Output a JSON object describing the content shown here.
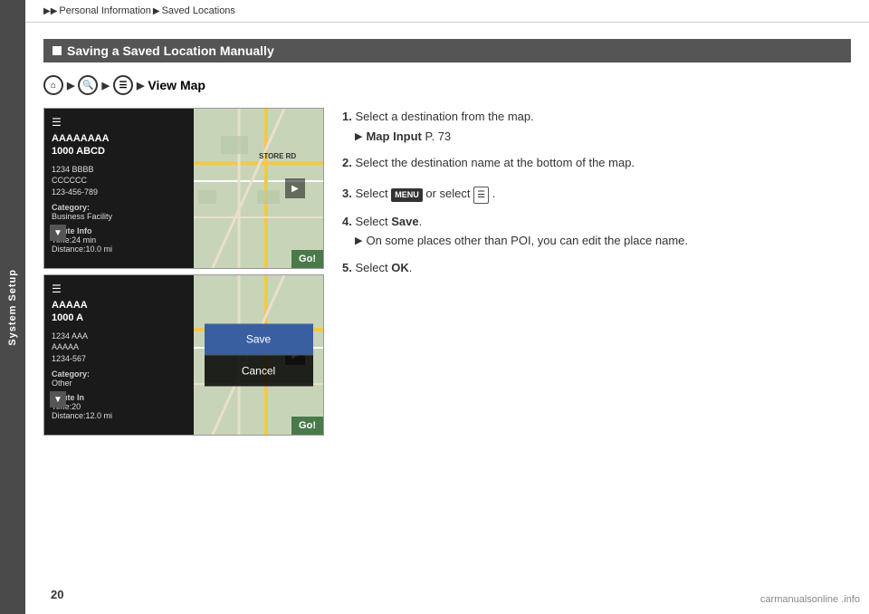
{
  "sidebar": {
    "label": "System Setup"
  },
  "breadcrumb": {
    "items": [
      "Personal Information",
      "Saved Locations"
    ]
  },
  "section": {
    "title": "Saving a Saved Location Manually"
  },
  "nav": {
    "icons": [
      "home",
      "search",
      "arrow",
      "menu"
    ],
    "label": "View Map"
  },
  "screenshot1": {
    "location_name": "AAAAAAAA\n1000 ABCD",
    "address_line1": "1234 BBBB",
    "address_line2": "CCCCCC",
    "address_line3": "123-456-789",
    "category_label": "Category:",
    "category_value": "Business Facility",
    "route_label": "Route Info",
    "route_time": "Time:24 min",
    "route_dist": "Distance:10.0 mi",
    "go_button": "Go!"
  },
  "screenshot2": {
    "location_name": "AAAAA\n1000 A",
    "address_line1": "1234 AAA",
    "address_line2": "AAAAA",
    "address_line3": "1234-567",
    "category_label": "Category:",
    "category_value": "Other",
    "route_label": "Route In",
    "route_time": "Time:20",
    "route_dist": "Distance:12.0 mi",
    "go_button": "Go!",
    "dialog": {
      "save_label": "Save",
      "cancel_label": "Cancel"
    }
  },
  "instructions": [
    {
      "num": "1.",
      "text": "Select a destination from the map.",
      "sub": {
        "icon": "arrow",
        "text": "Map Input",
        "suffix": " P. 73"
      }
    },
    {
      "num": "2.",
      "text": "Select the destination name at the bottom of the map."
    },
    {
      "num": "3.",
      "text_prefix": "Select ",
      "menu_btn": "MENU",
      "text_mid": " or select ",
      "list_btn": "≡",
      "text_suffix": "."
    },
    {
      "num": "4.",
      "text_prefix": "Select ",
      "bold": "Save",
      "text_suffix": ".",
      "sub": {
        "icon": "arrow",
        "text": "On some places other than POI, you can edit the place name."
      }
    },
    {
      "num": "5.",
      "text_prefix": "Select ",
      "bold": "OK",
      "text_suffix": "."
    }
  ],
  "page_number": "20",
  "watermark": "carmanualsonline .info"
}
